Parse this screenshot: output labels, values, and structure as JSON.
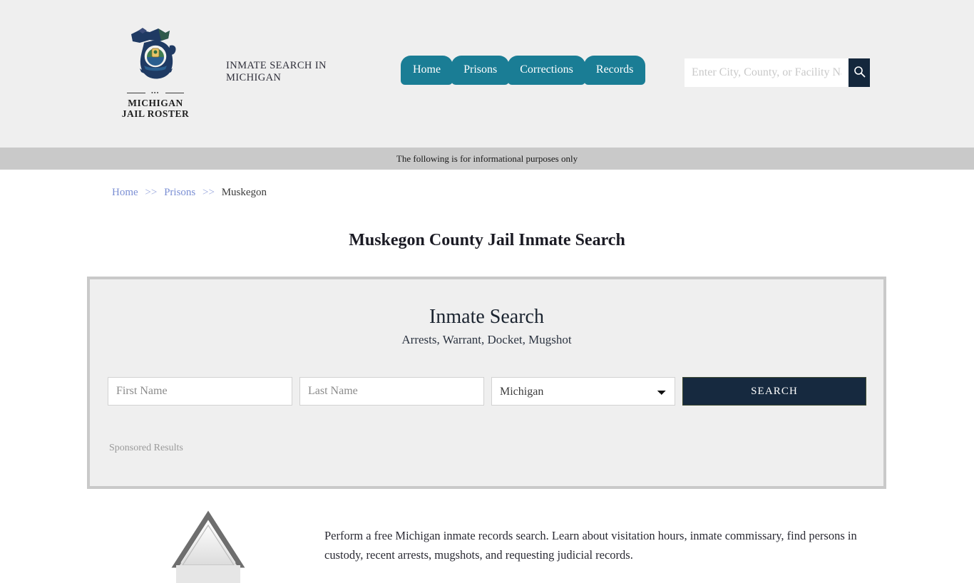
{
  "header": {
    "logo": {
      "line1": "MICHIGAN",
      "line2": "JAIL ROSTER",
      "icon": "michigan-state-outline-icon"
    },
    "tagline": "INMATE SEARCH IN MICHIGAN",
    "nav": [
      {
        "label": "Home"
      },
      {
        "label": "Prisons"
      },
      {
        "label": "Corrections"
      },
      {
        "label": "Records"
      }
    ],
    "search": {
      "value": "",
      "placeholder": "Enter City, County, or Facility Name",
      "button_icon": "search-icon"
    },
    "background": "#efefef"
  },
  "info_bar": {
    "text": "The following is for informational purposes only",
    "background": "#c9c9c9"
  },
  "breadcrumb": {
    "items": [
      {
        "label": "Home",
        "link": true
      },
      {
        "label": "Prisons",
        "link": true
      },
      {
        "label": "Muskegon",
        "link": false
      }
    ],
    "separator": ">>",
    "link_color": "#7b8fd4"
  },
  "page_title": "Muskegon County Jail Inmate Search",
  "search_panel": {
    "heading": "Inmate Search",
    "subheading": "Arrests, Warrant, Docket, Mugshot",
    "first_name": {
      "value": "",
      "placeholder": "First Name"
    },
    "last_name": {
      "value": "",
      "placeholder": "Last Name"
    },
    "state": {
      "selected": "Michigan",
      "options": [
        "Michigan"
      ]
    },
    "search_button": "SEARCH",
    "sponsored_label": "Sponsored Results",
    "panel_background": "#efefef",
    "panel_border": "#c9c9c9",
    "button_color": "#16293f"
  },
  "content": {
    "figure_icon": "courthouse-building-image",
    "paragraph": "Perform a free Michigan inmate records search. Learn about visitation hours, inmate commissary, find persons in custody, recent arrests, mugshots, and requesting judicial records."
  }
}
